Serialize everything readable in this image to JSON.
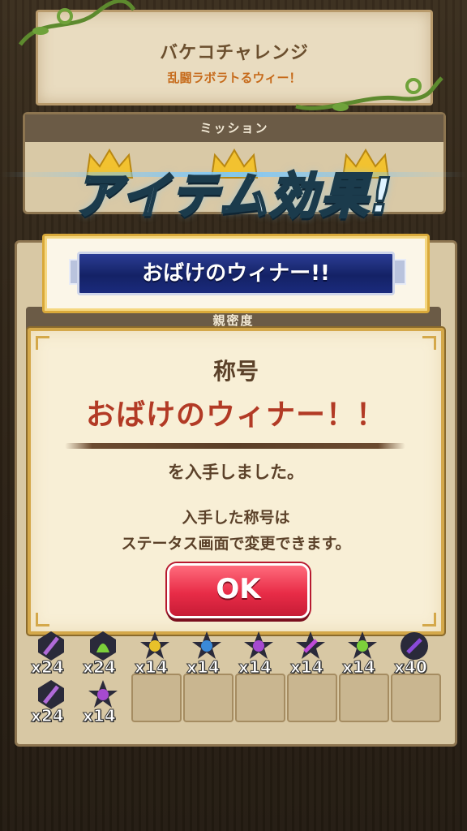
{
  "header": {
    "title": "バケコチャレンジ",
    "subtitle": "乱闘ラボラトるウィー！"
  },
  "mission": {
    "label": "ミッション"
  },
  "effect_banner": {
    "text": "アイテム効果!"
  },
  "title_banner": {
    "text": "おばけのウィナー!!"
  },
  "intimacy": {
    "label": "親密度"
  },
  "dialog": {
    "label": "称号",
    "title": "おばけのウィナー！！",
    "text1": "を入手しました。",
    "text2_line1": "入手した称号は",
    "text2_line2": "ステータス画面で変更できます。",
    "ok_label": "OK"
  },
  "items": [
    {
      "count": "x24",
      "icon": "purple-sword-icon"
    },
    {
      "count": "x24",
      "icon": "green-ghost-icon"
    },
    {
      "count": "x14",
      "icon": "yellow-star-icon"
    },
    {
      "count": "x14",
      "icon": "blue-star-icon"
    },
    {
      "count": "x14",
      "icon": "purple-star-icon"
    },
    {
      "count": "x14",
      "icon": "purple-sword-star-icon"
    },
    {
      "count": "x14",
      "icon": "green-star-icon"
    },
    {
      "count": "x40",
      "icon": "purple-orb-icon"
    },
    {
      "count": "x24",
      "icon": "purple-sword-icon"
    },
    {
      "count": "x14",
      "icon": "purple-star-icon"
    }
  ],
  "colors": {
    "accent_red": "#b23a25",
    "ok_red": "#e82c47",
    "title_plate_blue": "#142266",
    "parchment": "#f8efd6"
  }
}
